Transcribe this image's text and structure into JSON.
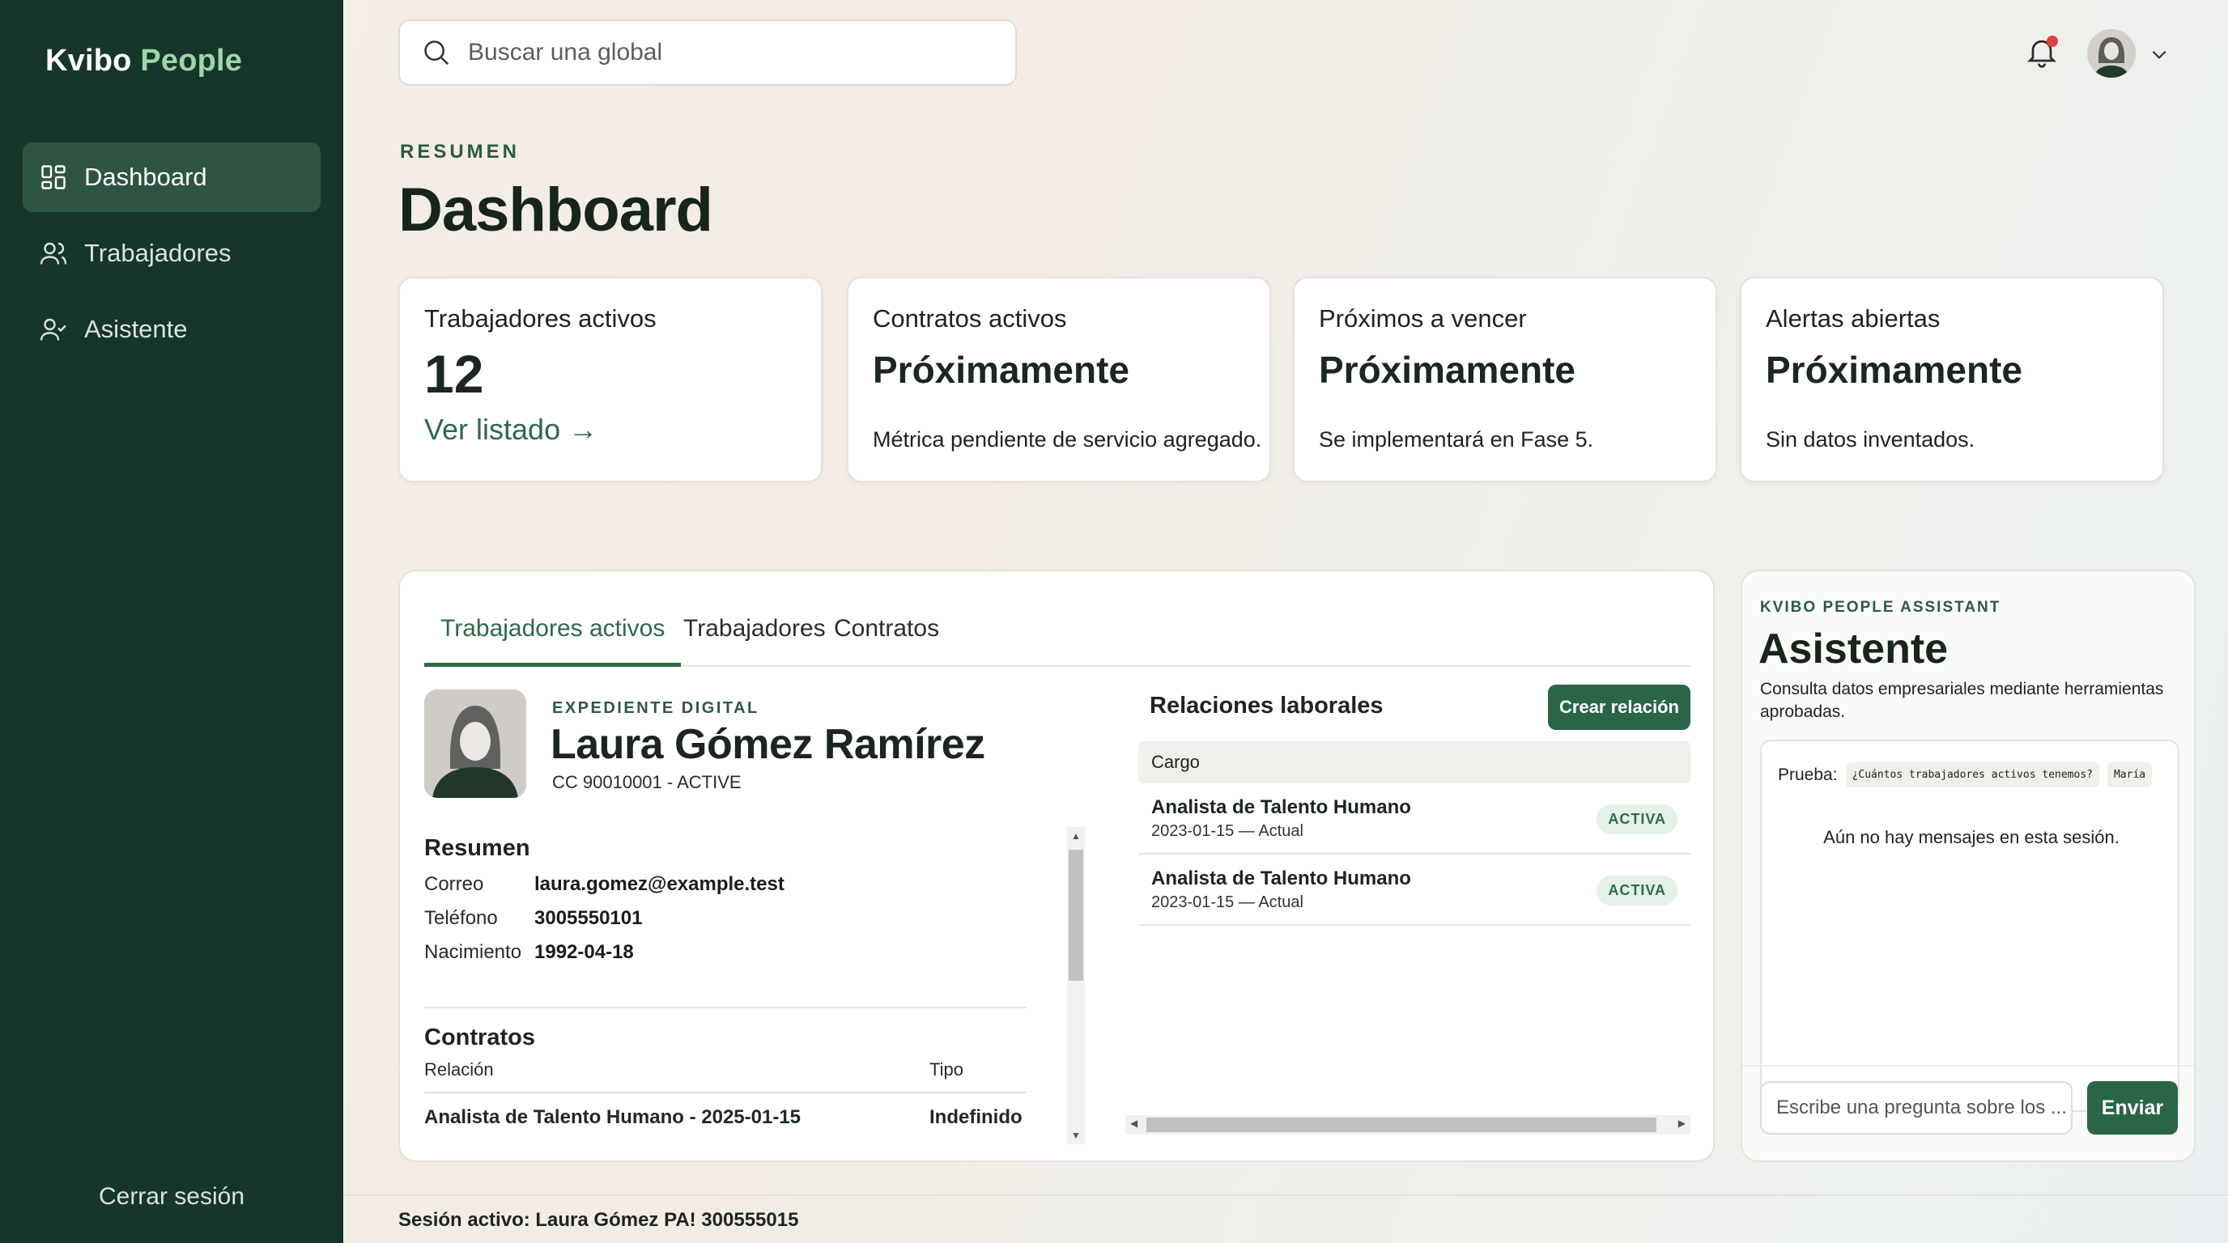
{
  "brand": {
    "name": "Kvibo",
    "accent": "People"
  },
  "sidebar": {
    "items": [
      {
        "label": "Dashboard",
        "icon": "dashboard-grid-icon",
        "active": true
      },
      {
        "label": "Trabajadores",
        "icon": "users-icon",
        "active": false
      },
      {
        "label": "Asistente",
        "icon": "user-check-icon",
        "active": false
      }
    ],
    "logout": "Cerrar sesión"
  },
  "search": {
    "placeholder": "Buscar una global"
  },
  "header": {
    "eyebrow": "RESUMEN",
    "title": "Dashboard",
    "notifications_icon": "bell-icon",
    "has_unread": true
  },
  "cards": [
    {
      "label": "Trabajadores activos",
      "value": "12",
      "link": "Ver listado →"
    },
    {
      "label": "Contratos activos",
      "value": "Próximamente",
      "desc": "Métrica pendiente de servicio agregado."
    },
    {
      "label": "Próximos a vencer",
      "value": "Próximamente",
      "desc": "Se implementará en Fase 5."
    },
    {
      "label": "Alertas abiertas",
      "value": "Próximamente",
      "desc": "Sin datos inventados."
    }
  ],
  "tabs": [
    "Trabajadores activos",
    "Trabajadores",
    "Contratos"
  ],
  "worker": {
    "eyebrow": "EXPEDIENTE DIGITAL",
    "name": "Laura Gómez Ramírez",
    "subtitle": "CC 90010001 - ACTIVE",
    "summary_title": "Resumen",
    "fields": [
      {
        "key": "Correo",
        "value": "laura.gomez@example.test"
      },
      {
        "key": "Teléfono",
        "value": "3005550101"
      },
      {
        "key": "Nacimiento",
        "value": "1992-04-18"
      }
    ],
    "contracts_title": "Contratos",
    "contracts_headers": [
      "Relación",
      "Tipo"
    ],
    "contracts_rows": [
      [
        "Analista de Talento Humano - 2025-01-15",
        "Indefinido"
      ]
    ]
  },
  "relations": {
    "title": "Relaciones laborales",
    "create_label": "Crear relación",
    "header": "Cargo",
    "rows": [
      {
        "title": "Analista de Talento Humano",
        "date": "2023-01-15 — Actual",
        "status": "ACTIVA"
      },
      {
        "title": "Analista de Talento Humano",
        "date": "2023-01-15 — Actual",
        "status": "ACTIVA"
      }
    ]
  },
  "assistant": {
    "eyebrow": "KVIBO PEOPLE ASSISTANT",
    "title": "Asistente",
    "description": "Consulta datos empresariales mediante herramientas aprobadas.",
    "try_label": "Prueba:",
    "chips": [
      "¿Cuántos trabajadores activos tenemos?",
      "María"
    ],
    "empty": "Aún no hay mensajes en esta sesión.",
    "input_placeholder": "Escribe una pregunta sobre los ...",
    "send_label": "Enviar"
  },
  "footer": {
    "session": "Sesión activo: Laura Gómez PA! 300555015"
  },
  "colors": {
    "sidebar": "#17362a",
    "accent": "#2b6548",
    "brand_accent": "#9fd6a8",
    "alert_dot": "#e04141"
  }
}
